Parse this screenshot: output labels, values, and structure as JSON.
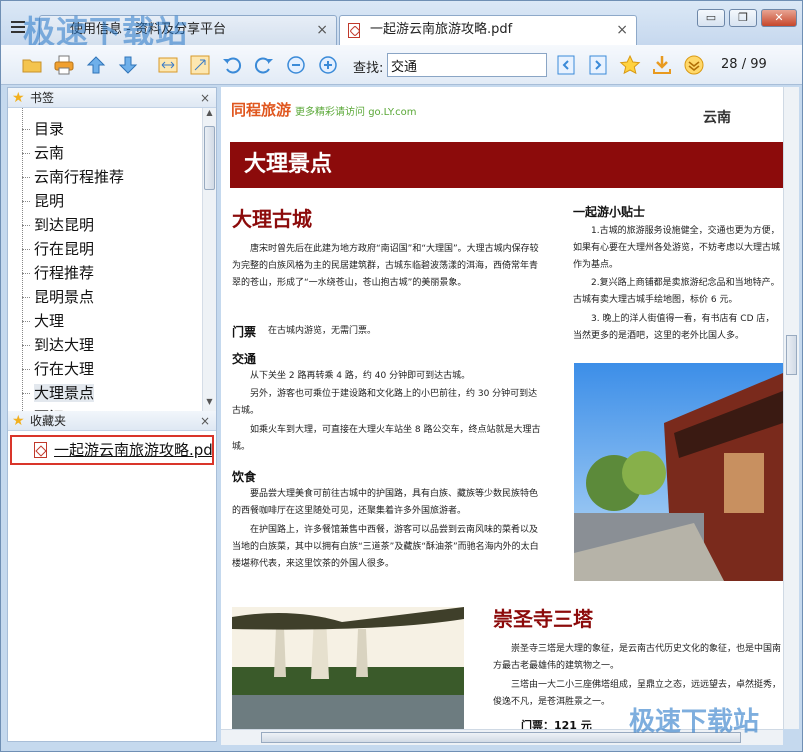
{
  "tabs": [
    {
      "label": "使用信息 - 资料及分享平台",
      "close": "×"
    },
    {
      "label": "一起游云南旅游攻略.pdf",
      "close": "×"
    }
  ],
  "window_controls": {
    "minimize": "▭",
    "restore": "❐",
    "close": "✕"
  },
  "watermark": "极速下载站",
  "toolbar": {
    "icons": [
      "open-folder-icon",
      "print-icon",
      "arrow-up-icon",
      "arrow-down-icon",
      "fit-width-icon",
      "fit-page-icon",
      "rotate-left-icon",
      "rotate-right-icon",
      "zoom-out-icon",
      "zoom-in-icon",
      "prev-result-icon",
      "next-result-icon",
      "favorite-star-icon",
      "download-icon",
      "more-chevron-icon"
    ],
    "find_label": "查找:",
    "find_value": "交通",
    "current_page": "28",
    "total_pages": "99",
    "page_separator": "/"
  },
  "bookmarks": {
    "title": "书签",
    "close": "×",
    "items": [
      "目录",
      "云南",
      "云南行程推荐",
      "昆明",
      "到达昆明",
      "行在昆明",
      "行程推荐",
      "昆明景点",
      "大理",
      "到达大理",
      "行在大理",
      "大理景点",
      "丽江"
    ],
    "selected_index": 11
  },
  "favorites": {
    "title": "收藏夹",
    "close": "×",
    "items": [
      "一起游云南旅游攻略.pdf"
    ]
  },
  "doc": {
    "brand": "同程旅游",
    "brand_sub": "更多精彩请访问 go.LY.com",
    "region": "云南",
    "banner": "大理景点",
    "section1_title": "大理古城",
    "s1_p1": "唐宋时曾先后在此建为地方政府“南诏国”和“大理国”。大理古城内保存较为完整的白族风格为主的民居建筑群，古城东临碧波荡漾的洱海，西倚常年青翠的苍山，形成了“一水绕苍山，苍山抱古城”的美丽景象。",
    "ticket_label": "门票",
    "ticket_text": "在古城内游览，无需门票。",
    "traffic_label": "交通",
    "traffic_p1": "从下关坐 2 路再转乘 4 路，约 40 分钟即可到达古城。",
    "traffic_p2": "另外，游客也可乘位于建设路和文化路上的小巴前往，约 30 分钟可到达古城。",
    "traffic_p3": "如乘火车到大理，可直接在大理火车站坐 8 路公交车，终点站就是大理古城。",
    "food_label": "饮食",
    "food_p1": "要品尝大理美食可前往古城中的护国路，具有白族、藏族等少数民族特色的西餐咖啡厅在这里随处可见，还聚集着许多外国旅游者。",
    "food_p2": "在护国路上，许多餐馆兼售中西餐，游客可以品尝到云南风味的菜肴以及当地的白族菜，其中以拥有白族“三道茶”及藏族“酥油茶”而驰名海内外的太白楼堪称代表，来这里饮茶的外国人很多。",
    "tips_title": "一起游小贴士",
    "tips_p1": "1.古城的旅游服务设施健全，交通也更为方便，如果有心要在大理州各处游览，不妨考虑以大理古城作为基点。",
    "tips_p2": "2.复兴路上商铺都是卖旅游纪念品和当地特产。古城有卖大理古城手绘地图，标价 6 元。",
    "tips_p3": "3. 晚上的洋人街值得一看，有书店有 CD 店，当然更多的是酒吧，这里的老外比国人多。",
    "section2_title": "崇圣寺三塔",
    "s2_p1": "崇圣寺三塔是大理的象征，是云南古代历史文化的象征，也是中国南方最古老最雄伟的建筑物之一。",
    "s2_p2": "三塔由一大二小三座佛塔组成，呈鼎立之态，远远望去，卓然挺秀，俊逸不凡，是苍洱胜景之一。",
    "s2_ticket": "门票：121 元"
  }
}
